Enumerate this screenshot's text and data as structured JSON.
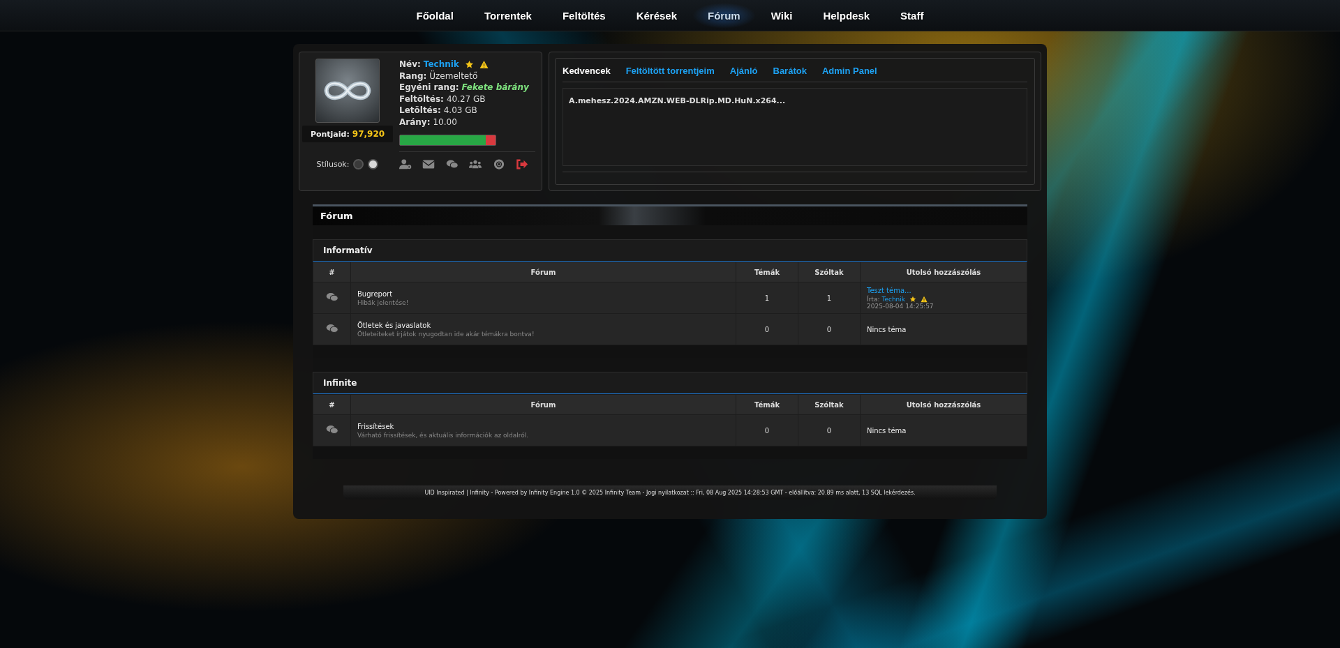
{
  "nav": [
    {
      "label": "Főoldal",
      "selected": false
    },
    {
      "label": "Torrentek",
      "selected": false
    },
    {
      "label": "Feltöltés",
      "selected": false
    },
    {
      "label": "Kérések",
      "selected": false
    },
    {
      "label": "Fórum",
      "selected": true
    },
    {
      "label": "Wiki",
      "selected": false
    },
    {
      "label": "Helpdesk",
      "selected": false
    },
    {
      "label": "Staff",
      "selected": false
    }
  ],
  "profile": {
    "points_label": "Pontjaid:",
    "points": "97,920",
    "styles_label": "Stílusok:",
    "styles": [
      {
        "color": "#3a3a3a"
      },
      {
        "color": "#d9d9d9"
      }
    ],
    "fields": [
      {
        "kind": "user",
        "label": "Név:",
        "value": "Technik"
      },
      {
        "kind": "plain",
        "label": "Rang:",
        "value": "Üzemeltető"
      },
      {
        "kind": "custom",
        "label": "Egyéni rang:",
        "value": "Fekete bárány"
      },
      {
        "kind": "plain",
        "label": "Feltöltés:",
        "value": "40.27 GB"
      },
      {
        "kind": "plain",
        "label": "Letöltés:",
        "value": "4.03 GB"
      },
      {
        "kind": "plain",
        "label": "Arány:",
        "value": "10.00"
      }
    ],
    "ratio_bar": {
      "level": 0.9
    }
  },
  "tabs": [
    {
      "label": "Kedvencek",
      "selected": true
    },
    {
      "label": "Feltöltött torrentjeim",
      "selected": false
    },
    {
      "label": "Ajánló",
      "selected": false
    },
    {
      "label": "Barátok",
      "selected": false
    },
    {
      "label": "Admin Panel",
      "selected": false
    }
  ],
  "favorites": [
    "A.mehesz.2024.AMZN.WEB-DLRip.MD.HuN.x264..."
  ],
  "forum": {
    "title": "Fórum",
    "categories": [
      {
        "name": "Informatív",
        "columns": [
          "#",
          "Fórum",
          "Témák",
          "Szóltak",
          "Utolsó hozzászólás"
        ],
        "rows": [
          {
            "name": "Bugreport",
            "description": "Hibák jelentése!",
            "topics": "1",
            "posts": "1",
            "last": {
              "kind": "post",
              "title": "Teszt téma...",
              "by_label": "Írta:",
              "author": "Technik",
              "date": "2025-08-04 14:25:57"
            }
          },
          {
            "name": "Ötletek és javaslatok",
            "description": "Ötleteiteket írjátok nyugodtan ide akár témákra bontva!",
            "topics": "0",
            "posts": "0",
            "last": {
              "kind": "none",
              "text": "Nincs téma"
            }
          }
        ]
      },
      {
        "name": "Infinite",
        "columns": [
          "#",
          "Fórum",
          "Témák",
          "Szóltak",
          "Utolsó hozzászólás"
        ],
        "rows": [
          {
            "name": "Frissítések",
            "description": "Várható frissítések, és aktuális információk az oldalról.",
            "topics": "0",
            "posts": "0",
            "last": {
              "kind": "none",
              "text": "Nincs téma"
            }
          }
        ]
      }
    ]
  },
  "footer": "UID Inspirated | Infinity - Powered by Infinity Engine 1.0 © 2025 Infinity Team - Jogi nyilatkozat :: Fri, 08 Aug 2025 14:28:53 GMT - előállítva: 20.89 ms alatt, 13 SQL lekérdezés."
}
